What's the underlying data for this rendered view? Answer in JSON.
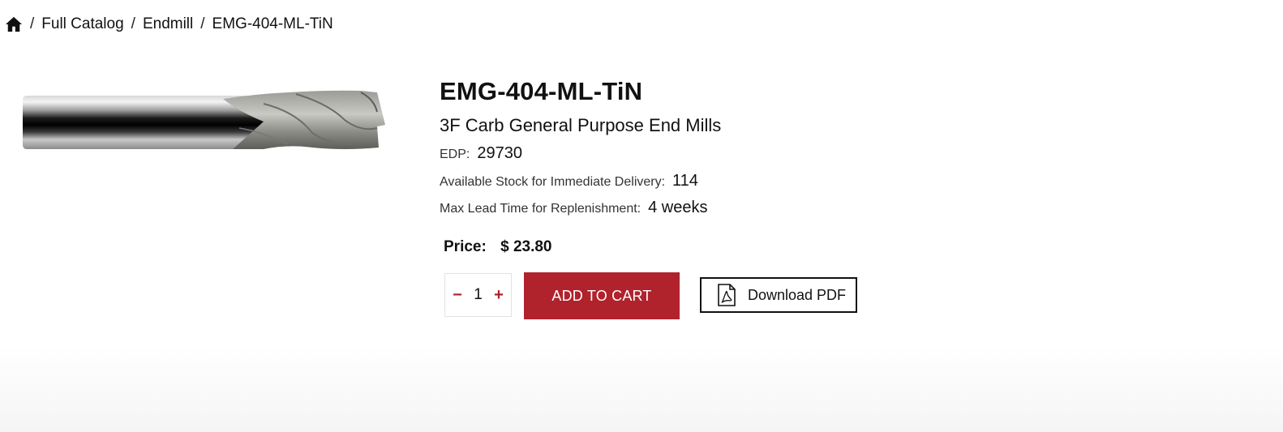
{
  "breadcrumb": {
    "home_icon": "home-icon",
    "items": [
      "Full Catalog",
      "Endmill",
      "EMG-404-ML-TiN"
    ],
    "separator": "/"
  },
  "product": {
    "image_icon": "end-mill-image",
    "title": "EMG-404-ML-TiN",
    "subtitle": "3F Carb General Purpose End Mills",
    "edp_label": "EDP:",
    "edp_value": "29730",
    "stock_label": "Available Stock for Immediate Delivery:",
    "stock_value": "114",
    "lead_label": "Max Lead Time for Replenishment:",
    "lead_value": "4 weeks",
    "price_label": "Price:",
    "price_value": "$ 23.80"
  },
  "actions": {
    "qty_minus": "−",
    "qty_value": "1",
    "qty_plus": "+",
    "add_to_cart": "ADD TO CART",
    "download_pdf": "Download PDF",
    "pdf_icon": "pdf-file-icon"
  },
  "colors": {
    "accent": "#b0222c",
    "text": "#111111"
  }
}
